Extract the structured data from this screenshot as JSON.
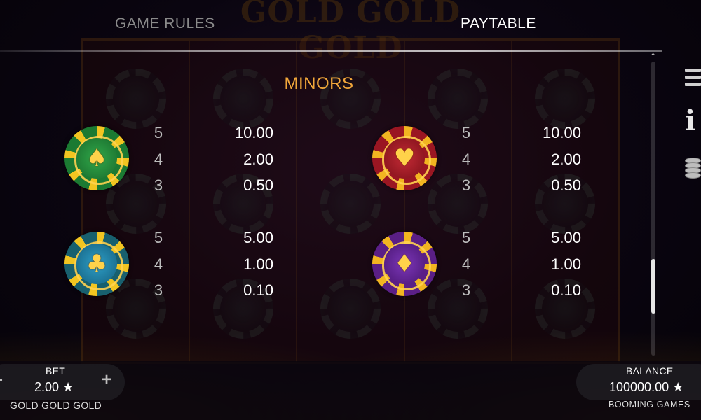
{
  "background": {
    "title": "GOLD GOLD GOLD"
  },
  "tabs": [
    {
      "label": "GAME RULES",
      "active": false
    },
    {
      "label": "PAYTABLE",
      "active": true
    }
  ],
  "paytable": {
    "section_title": "MINORS",
    "symbols": [
      {
        "name": "spade-chip-icon",
        "color": "#1b7a32",
        "glyph": "♠",
        "pays": [
          {
            "count": "5",
            "amount": "10.00"
          },
          {
            "count": "4",
            "amount": "2.00"
          },
          {
            "count": "3",
            "amount": "0.50"
          }
        ]
      },
      {
        "name": "heart-chip-icon",
        "color": "#9a1622",
        "glyph": "♥",
        "pays": [
          {
            "count": "5",
            "amount": "10.00"
          },
          {
            "count": "4",
            "amount": "2.00"
          },
          {
            "count": "3",
            "amount": "0.50"
          }
        ]
      },
      {
        "name": "club-chip-icon",
        "color": "#18606e",
        "glyph": "♣",
        "pays": [
          {
            "count": "5",
            "amount": "5.00"
          },
          {
            "count": "4",
            "amount": "1.00"
          },
          {
            "count": "3",
            "amount": "0.10"
          }
        ]
      },
      {
        "name": "diamond-chip-icon",
        "color": "#5a1f86",
        "glyph": "♦",
        "pays": [
          {
            "count": "5",
            "amount": "5.00"
          },
          {
            "count": "4",
            "amount": "1.00"
          },
          {
            "count": "3",
            "amount": "0.10"
          }
        ]
      }
    ]
  },
  "side_icons": [
    "menu-icon",
    "info-icon",
    "coins-icon"
  ],
  "bottom": {
    "bet_label": "BET",
    "bet_value": "2.00 ★",
    "minus": "-",
    "plus": "+",
    "balance_label": "BALANCE",
    "balance_value": "100000.00 ★",
    "game_name": "GOLD GOLD GOLD",
    "brand": "BOOMING GAMES"
  },
  "colors": {
    "section_title": "#f0a63a",
    "inactive_tab": "#8a8a8a"
  }
}
